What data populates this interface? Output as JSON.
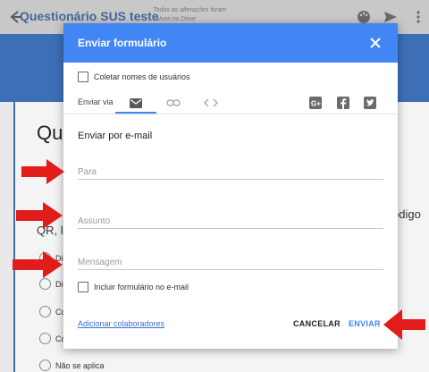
{
  "app": {
    "title": "Questionário SUS teste",
    "saved_status": "Todas as alterações foram salvas no Drive"
  },
  "form": {
    "question_title": "Que",
    "side_text": "ódigo",
    "qr_text": "QR, lis",
    "options": [
      "Di",
      "Di",
      "Co",
      "Co",
      "Não se aplica"
    ]
  },
  "dialog": {
    "title": "Enviar formulário",
    "collect_label": "Coletar nomes de usuários",
    "send_via_label": "Enviar via",
    "section_title": "Enviar por e-mail",
    "to_placeholder": "Para",
    "subject_placeholder": "Assunto",
    "message_placeholder": "Mensagem",
    "include_label": "Incluir formulário no e-mail",
    "add_collaborators": "Adicionar colaboradores",
    "cancel": "CANCELAR",
    "send": "ENVIAR"
  },
  "colors": {
    "header_blue": "#4285f4",
    "band_blue": "#3d6fb7",
    "arrow_red": "#e21b1b",
    "link_blue": "#3b6fd0"
  }
}
